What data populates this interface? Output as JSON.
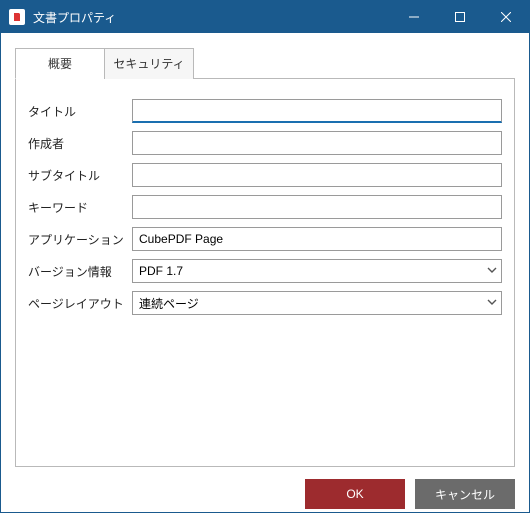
{
  "window": {
    "title": "文書プロパティ"
  },
  "tabs": {
    "overview": "概要",
    "security": "セキュリティ"
  },
  "fields": {
    "title_label": "タイトル",
    "title_value": "",
    "author_label": "作成者",
    "author_value": "",
    "subtitle_label": "サブタイトル",
    "subtitle_value": "",
    "keyword_label": "キーワード",
    "keyword_value": "",
    "application_label": "アプリケーション",
    "application_value": "CubePDF Page",
    "version_label": "バージョン情報",
    "version_value": "PDF 1.7",
    "layout_label": "ページレイアウト",
    "layout_value": "連続ページ"
  },
  "buttons": {
    "ok": "OK",
    "cancel": "キャンセル"
  }
}
